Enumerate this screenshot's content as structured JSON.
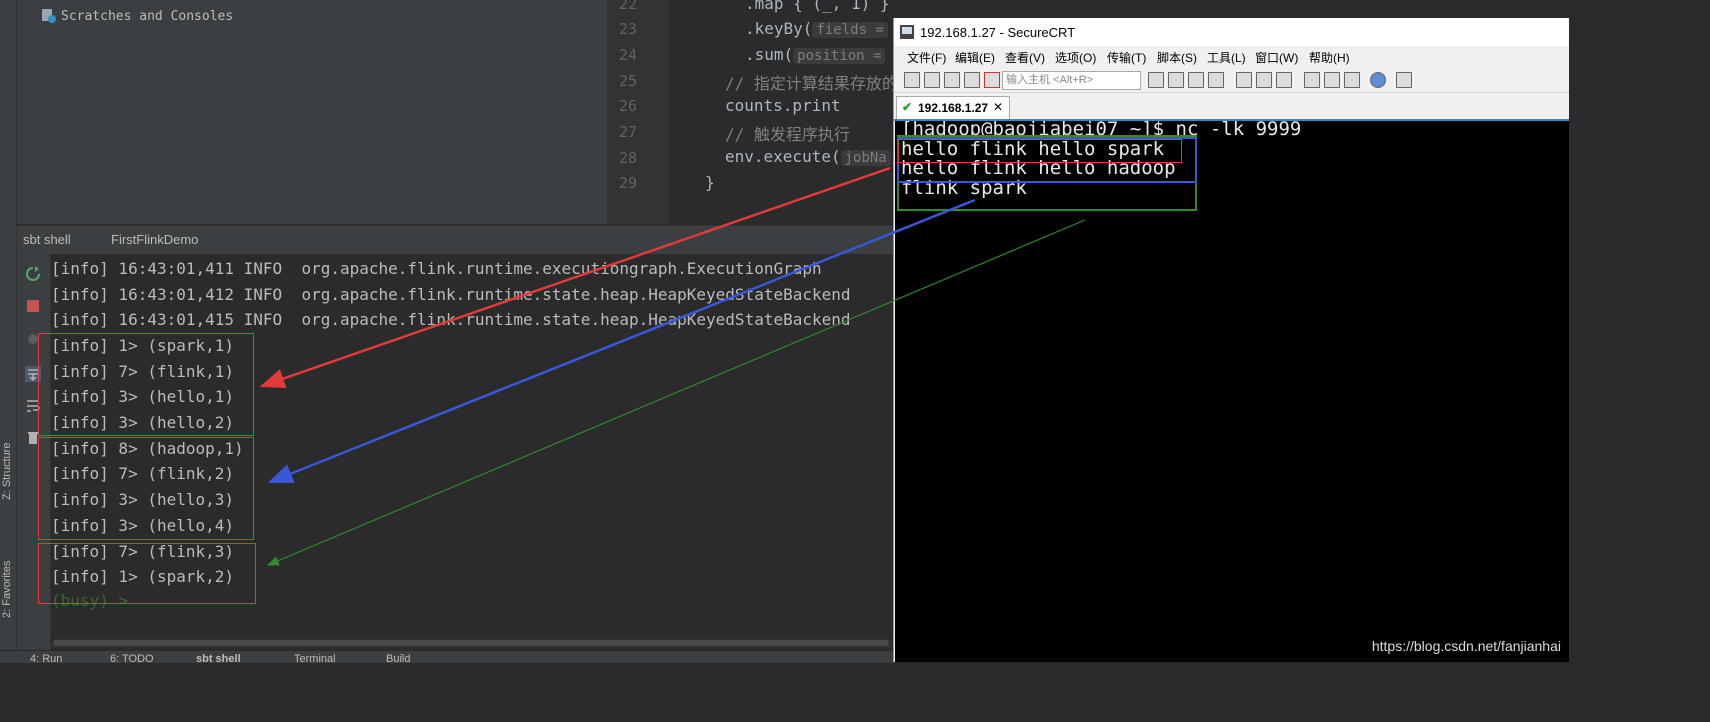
{
  "ide": {
    "project_item": "Scratches and Consoles",
    "editor": {
      "lines": [
        {
          "num": "22",
          "text": ".map { (_, 1) }"
        },
        {
          "num": "23",
          "text": ".keyBy(",
          "hint": "fields ="
        },
        {
          "num": "24",
          "text": ".sum(",
          "hint": "position ="
        },
        {
          "num": "25",
          "text": "// 指定计算结果存放的",
          "comment": true
        },
        {
          "num": "26",
          "text": "counts.print"
        },
        {
          "num": "27",
          "text": "// 触发程序执行",
          "comment": true
        },
        {
          "num": "28",
          "text": "env.execute(",
          "hint": "jobNa"
        },
        {
          "num": "29",
          "text": "}"
        }
      ]
    },
    "tabs": [
      "sbt shell",
      "FirstFlinkDemo"
    ],
    "console_lines": [
      "[info] 16:43:01,411 INFO  org.apache.flink.runtime.executiongraph.ExecutionGraph",
      "[info] 16:43:01,412 INFO  org.apache.flink.runtime.state.heap.HeapKeyedStateBackend",
      "[info] 16:43:01,415 INFO  org.apache.flink.runtime.state.heap.HeapKeyedStateBackend",
      "[info] 1> (spark,1)",
      "[info] 7> (flink,1)",
      "[info] 3> (hello,1)",
      "[info] 3> (hello,2)",
      "[info] 8> (hadoop,1)",
      "[info] 7> (flink,2)",
      "[info] 3> (hello,3)",
      "[info] 3> (hello,4)",
      "[info] 7> (flink,3)",
      "[info] 1> (spark,2)"
    ],
    "busy": "(busy) >",
    "side_labels": [
      "Z: Structure",
      "2: Favorites"
    ],
    "bottom_tabs": [
      "4: Run",
      "6: TODO",
      "sbt shell",
      "Terminal",
      "Build"
    ]
  },
  "crt": {
    "title": "192.168.1.27 - SecureCRT",
    "menu": [
      "文件(F)",
      "编辑(E)",
      "查看(V)",
      "选项(O)",
      "传输(T)",
      "脚本(S)",
      "工具(L)",
      "窗口(W)",
      "帮助(H)"
    ],
    "host_placeholder": "输入主机 <Alt+R>",
    "tab_label": "192.168.1.27",
    "terminal_lines": [
      "[hadoop@baojiabei07 ~]$ nc -lk 9999",
      "hello flink hello spark",
      "hello flink hello hadoop",
      "flink spark"
    ]
  },
  "watermark": "https://blog.csdn.net/fanjianhai",
  "colors": {
    "red": "#e03a3a",
    "blue": "#3a57d6",
    "green": "#2e8b2e"
  }
}
